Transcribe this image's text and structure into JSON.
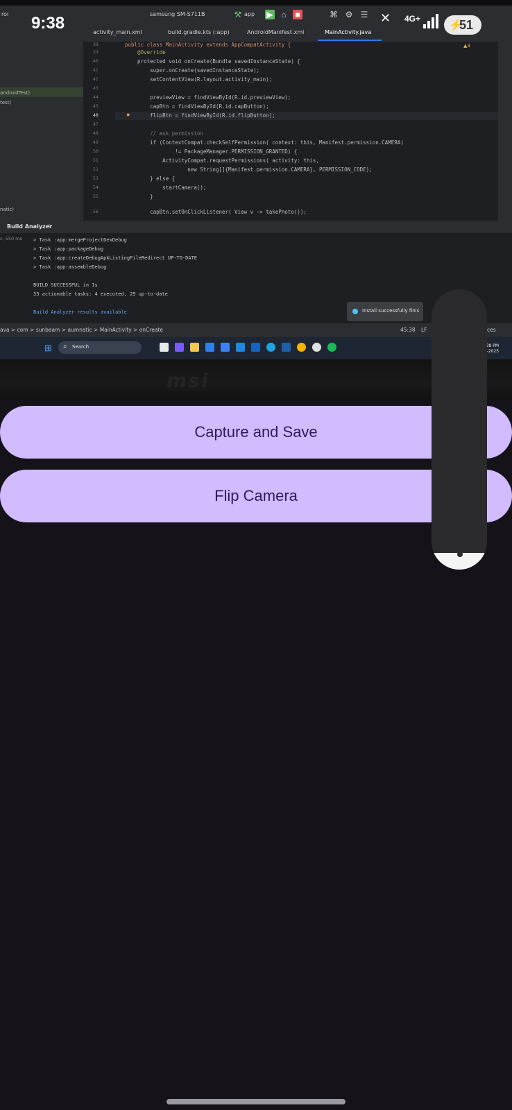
{
  "status_bar": {
    "time": "9:38",
    "network": "4G+",
    "battery": "51"
  },
  "camera_preview": {
    "ide": {
      "toolbar": {
        "project": "roi",
        "device": "samsung SM-S711B",
        "run_config": "app"
      },
      "tabs": [
        "activity_main.xml",
        "build.gradle.kts (:app)",
        "AndroidManifest.xml",
        "MainActivity.java"
      ],
      "project_pane": [
        "androidTest)",
        "test)",
        "natic)"
      ],
      "editor": {
        "warnings": "▲3",
        "line_numbers": [
          "38",
          "39",
          "40",
          "41",
          "42",
          "43",
          "44",
          "45",
          "46",
          "47",
          "48",
          "49",
          "50",
          "51",
          "52",
          "53",
          "54",
          "55",
          "56"
        ],
        "lines": [
          "public class MainActivity extends AppCompatActivity {",
          "    @Override",
          "    protected void onCreate(Bundle savedInstanceState) {",
          "        super.onCreate(savedInstanceState);",
          "        setContentView(R.layout.activity_main);",
          "",
          "        previewView = findViewById(R.id.previewView);",
          "        capBtn = findViewById(R.id.capButton);",
          "        flipBtn = findViewById(R.id.flipButton);",
          "",
          "        // ask permission",
          "        if (ContextCompat.checkSelfPermission( context: this, Manifest.permission.CAMERA)",
          "                != PackageManager.PERMISSION_GRANTED) {",
          "            ActivityCompat.requestPermissions( activity: this,",
          "                    new String[]{Manifest.permission.CAMERA}, PERMISSION_CODE);",
          "        } else {",
          "            startCamera();",
          "        }",
          "",
          "        capBtn.setOnClickListener( View v -> takePhoto());"
        ]
      },
      "build_panel": {
        "title": "Build Analyzer",
        "left_time": "c, 550 ms",
        "lines": [
          "> Task :app:mergeProjectDexDebug",
          "> Task :app:packageDebug",
          "> Task :app:createDebugApkListingFileRedirect UP-TO-DATE",
          "> Task :app:assembleDebug",
          "",
          "BUILD SUCCESSFUL in 1s",
          "33 actionable tasks: 4 executed, 29 up-to-date",
          "",
          "Build Analyzer results available"
        ]
      },
      "toast": "Install successfully finis",
      "statusbar": {
        "breadcrumb": "ava  >  com  >  sunbeam  >  aumnatic  >  MainActivity  >  onCreate",
        "position": "45:38",
        "encoding": "LF",
        "right": "ces"
      }
    },
    "taskbar": {
      "search_label": "Search",
      "time": "09:38 PM",
      "date": "9-09-2025"
    },
    "brand": "msi"
  },
  "buttons": {
    "capture_label": "Capture and Save",
    "flip_label": "Flip Camera"
  },
  "volume": {
    "level": 0.06
  },
  "colors": {
    "background": "#15121a",
    "button_bg": "#d0bcff",
    "button_text": "#2e1c59"
  }
}
